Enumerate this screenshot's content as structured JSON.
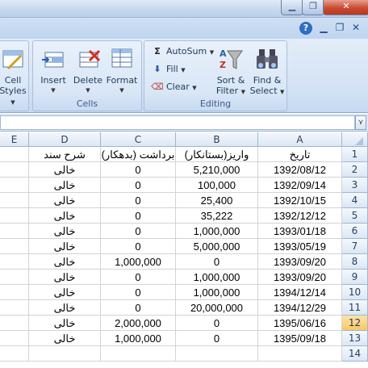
{
  "ribbon": {
    "groups": {
      "styles": {
        "cell_styles_line1": "Cell",
        "cell_styles_line2": "Styles"
      },
      "cells": {
        "label": "Cells",
        "insert": "Insert",
        "delete": "Delete",
        "format": "Format"
      },
      "editing": {
        "label": "Editing",
        "autosum": "AutoSum",
        "fill": "Fill",
        "clear": "Clear",
        "sort_filter_line1": "Sort &",
        "sort_filter_line2": "Filter",
        "find_select_line1": "Find &",
        "find_select_line2": "Select"
      }
    }
  },
  "sheet": {
    "columns": [
      "E",
      "D",
      "C",
      "B",
      "A"
    ],
    "row_numbers": [
      "1",
      "2",
      "3",
      "4",
      "5",
      "6",
      "7",
      "8",
      "9",
      "10",
      "11",
      "12",
      "13",
      "14"
    ],
    "selected_row": "12",
    "rows": [
      {
        "d": "شرح سند",
        "c": "برداشت (بدهکار)",
        "b": "واریز(بستانکار)",
        "a": "تاریخ"
      },
      {
        "d": "خالی",
        "c": "0",
        "b": "5,210,000",
        "a": "1392/08/12"
      },
      {
        "d": "خالی",
        "c": "0",
        "b": "100,000",
        "a": "1392/09/14"
      },
      {
        "d": "خالی",
        "c": "0",
        "b": "25,400",
        "a": "1392/10/15"
      },
      {
        "d": "خالی",
        "c": "0",
        "b": "35,222",
        "a": "1392/12/12"
      },
      {
        "d": "خالی",
        "c": "0",
        "b": "1,000,000",
        "a": "1393/01/18"
      },
      {
        "d": "خالی",
        "c": "0",
        "b": "5,000,000",
        "a": "1393/05/19"
      },
      {
        "d": "خالی",
        "c": "1,000,000",
        "b": "0",
        "a": "1393/09/20"
      },
      {
        "d": "خالی",
        "c": "0",
        "b": "1,000,000",
        "a": "1393/09/20"
      },
      {
        "d": "خالی",
        "c": "0",
        "b": "1,000,000",
        "a": "1394/12/14"
      },
      {
        "d": "خالی",
        "c": "0",
        "b": "20,000,000",
        "a": "1394/12/29"
      },
      {
        "d": "خالی",
        "c": "2,000,000",
        "b": "0",
        "a": "1395/06/16"
      },
      {
        "d": "خالی",
        "c": "1,000,000",
        "b": "0",
        "a": "1395/09/18"
      },
      {
        "d": "",
        "c": "",
        "b": "",
        "a": ""
      }
    ]
  },
  "colors": {
    "accent": "#2f6ec0",
    "selected_row": "#f9c867",
    "close": "#c84a30"
  }
}
